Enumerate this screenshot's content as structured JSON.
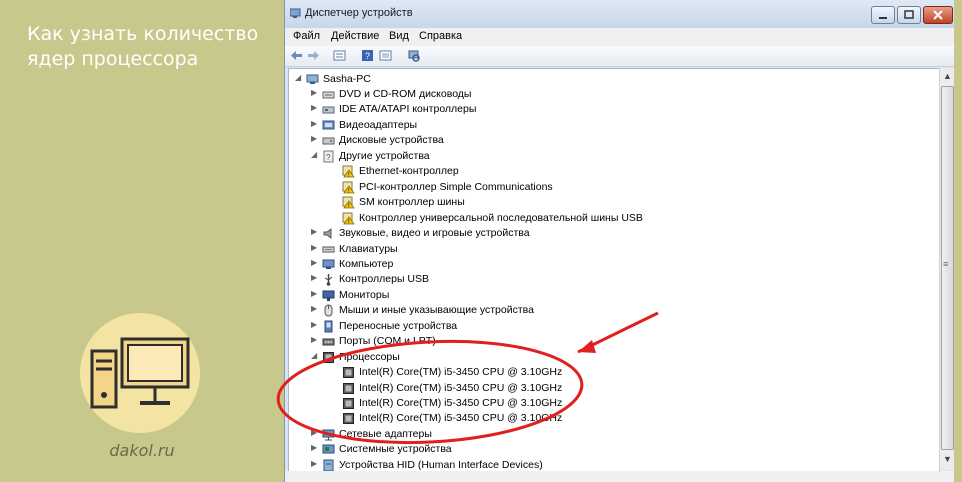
{
  "promo": {
    "headline": "Как узнать количество ядер процессора",
    "site": "dakol.ru"
  },
  "window": {
    "title": "Диспетчер устройств",
    "menu": [
      "Файл",
      "Действие",
      "Вид",
      "Справка"
    ]
  },
  "tree": {
    "root": "Sasha-PC",
    "items": [
      {
        "label": "DVD и CD-ROM дисководы",
        "icon": "dvd-drive-icon"
      },
      {
        "label": "IDE ATA/ATAPI контроллеры",
        "icon": "ide-controller-icon"
      },
      {
        "label": "Видеоадаптеры",
        "icon": "display-adapter-icon"
      },
      {
        "label": "Дисковые устройства",
        "icon": "disk-drive-icon"
      },
      {
        "label": "Другие устройства",
        "icon": "other-devices-icon",
        "expanded": true
      },
      {
        "label": "Ethernet-контроллер",
        "icon": "warning-device-icon",
        "child": true
      },
      {
        "label": "PCI-контроллер Simple Communications",
        "icon": "warning-device-icon",
        "child": true
      },
      {
        "label": "SM контроллер шины",
        "icon": "warning-device-icon",
        "child": true
      },
      {
        "label": "Контроллер универсальной последовательной шины USB",
        "icon": "warning-device-icon",
        "child": true
      },
      {
        "label": "Звуковые, видео и игровые устройства",
        "icon": "speaker-icon"
      },
      {
        "label": "Клавиатуры",
        "icon": "keyboard-icon"
      },
      {
        "label": "Компьютер",
        "icon": "computer-icon"
      },
      {
        "label": "Контроллеры USB",
        "icon": "usb-icon"
      },
      {
        "label": "Мониторы",
        "icon": "monitor-icon"
      },
      {
        "label": "Мыши и иные указывающие устройства",
        "icon": "mouse-icon"
      },
      {
        "label": "Переносные устройства",
        "icon": "portable-device-icon"
      },
      {
        "label": "Порты (COM и LPT)",
        "icon": "port-icon"
      },
      {
        "label": "Процессоры",
        "icon": "processor-icon",
        "expanded": true
      },
      {
        "label": "Intel(R) Core(TM) i5-3450 CPU @ 3.10GHz",
        "icon": "processor-icon",
        "child": true
      },
      {
        "label": "Intel(R) Core(TM) i5-3450 CPU @ 3.10GHz",
        "icon": "processor-icon",
        "child": true
      },
      {
        "label": "Intel(R) Core(TM) i5-3450 CPU @ 3.10GHz",
        "icon": "processor-icon",
        "child": true
      },
      {
        "label": "Intel(R) Core(TM) i5-3450 CPU @ 3.10GHz",
        "icon": "processor-icon",
        "child": true
      },
      {
        "label": "Сетевые адаптеры",
        "icon": "network-adapter-icon"
      },
      {
        "label": "Системные устройства",
        "icon": "system-device-icon"
      },
      {
        "label": "Устройства HID (Human Interface Devices)",
        "icon": "hid-device-icon"
      }
    ]
  },
  "colors": {
    "panel": "#c8c88c",
    "annotation": "#e0201e"
  }
}
